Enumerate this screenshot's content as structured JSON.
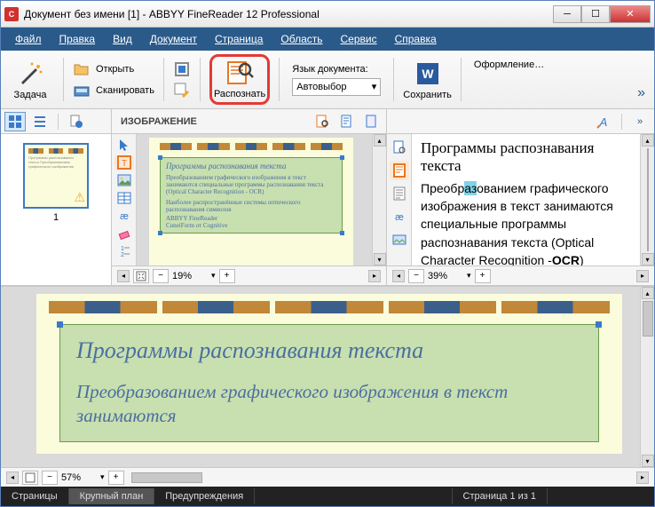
{
  "title": "Документ без имени [1] - ABBYY FineReader 12 Professional",
  "menu": {
    "file": "Файл",
    "edit": "Правка",
    "view": "Вид",
    "document": "Документ",
    "page": "Страница",
    "area": "Область",
    "service": "Сервис",
    "help": "Справка"
  },
  "ribbon": {
    "task": "Задача",
    "open": "Открыть",
    "scan": "Сканировать",
    "recognize": "Распознать",
    "lang_label": "Язык документа:",
    "lang_value": "Автовыбор",
    "save": "Сохранить",
    "design": "Оформление…"
  },
  "pane": {
    "image_label": "ИЗОБРАЖЕНИЕ",
    "zoom_image": "19%",
    "zoom_text": "39%",
    "zoom_lower": "57%"
  },
  "thumb_label": "1",
  "text_content": {
    "h1": "Программы распознавания текста",
    "p1a": "Преобр",
    "p1b": "аз",
    "p1c": "ованием графического изображения в текст занимаются специальные программы распознавания текста (Optical Character Recognition -",
    "p1d": "OCR",
    "p1e": ")"
  },
  "img_text": {
    "h": "Программы распознавания текста",
    "p1": "Преобразованием графического изображения в текст занимаются специальные программы распознавания текста (Optical Character Recognition - OCR)",
    "p2": "Наиболее распространённые системы оптического распознавания символов",
    "li1": "ABBYY FineReader",
    "li2": "CuneiForm от Cognitive"
  },
  "lower_text": {
    "h": "Программы распознавания текста",
    "p": "Преобразованием графического изображения в текст занимаются"
  },
  "status": {
    "pages": "Страницы",
    "closeup": "Крупный план",
    "warnings": "Предупреждения",
    "pageinfo": "Страница 1 из 1"
  }
}
